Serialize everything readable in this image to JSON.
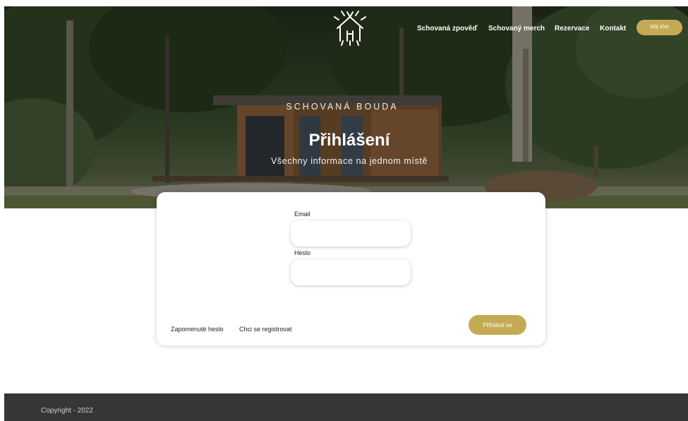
{
  "nav": {
    "logo_icon": "cabin-branches-logo-icon",
    "items": [
      {
        "label": "Schovaná zpověď"
      },
      {
        "label": "Schovaný merch"
      },
      {
        "label": "Rezervace"
      },
      {
        "label": "Kontakt"
      }
    ],
    "account_button": "Můj účet"
  },
  "hero": {
    "kicker": "SCHOVANÁ BOUDA",
    "title": "Přihlášení",
    "subtitle": "Všechny informace na jednom místě"
  },
  "login": {
    "email_label": "Email",
    "email_value": "",
    "password_label": "Heslo",
    "password_value": "",
    "forgot_link": "Zapomenuté heslo",
    "register_link": "Chci se registrovat",
    "submit": "Přihlásit se"
  },
  "footer": {
    "copyright": "Copyright - 2022"
  },
  "colors": {
    "accent": "#c5aa55",
    "footer_bg": "#363636",
    "card_bg": "#ffffff"
  }
}
